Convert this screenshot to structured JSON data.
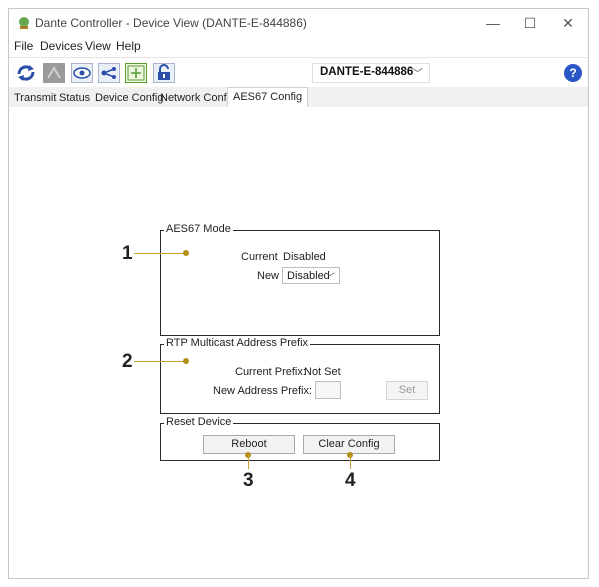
{
  "window": {
    "title": "Dante Controller - Device View (DANTE-E-844886)",
    "controls": {
      "minimize": "—",
      "maximize": "☐",
      "close": "✕"
    }
  },
  "menu": [
    "File",
    "Devices",
    "View",
    "Help"
  ],
  "toolbar": {
    "icons": [
      "refresh-icon",
      "device-info-icon",
      "eye-icon",
      "share-icon",
      "add-icon",
      "lock-icon"
    ],
    "device_select": "DANTE-E-844886",
    "help": "?"
  },
  "tabs": [
    "Transmit",
    "Status",
    "Device Config",
    "Network Config",
    "AES67 Config"
  ],
  "active_tab": "AES67 Config",
  "aes67_mode": {
    "title": "AES67 Mode",
    "current_label": "Current",
    "current_value": "Disabled",
    "new_label": "New",
    "new_value": "Disabled"
  },
  "rtp_prefix": {
    "title": "RTP Multicast Address Prefix",
    "current_label": "Current Prefix:",
    "current_value": "Not Set",
    "new_label": "New Address Prefix:",
    "new_value": "",
    "set_label": "Set"
  },
  "reset_device": {
    "title": "Reset Device",
    "reboot_label": "Reboot",
    "clear_label": "Clear Config"
  },
  "callouts": [
    "1",
    "2",
    "3",
    "4"
  ],
  "colors": {
    "callout": "#c7a22e",
    "help": "#2a56c6"
  }
}
